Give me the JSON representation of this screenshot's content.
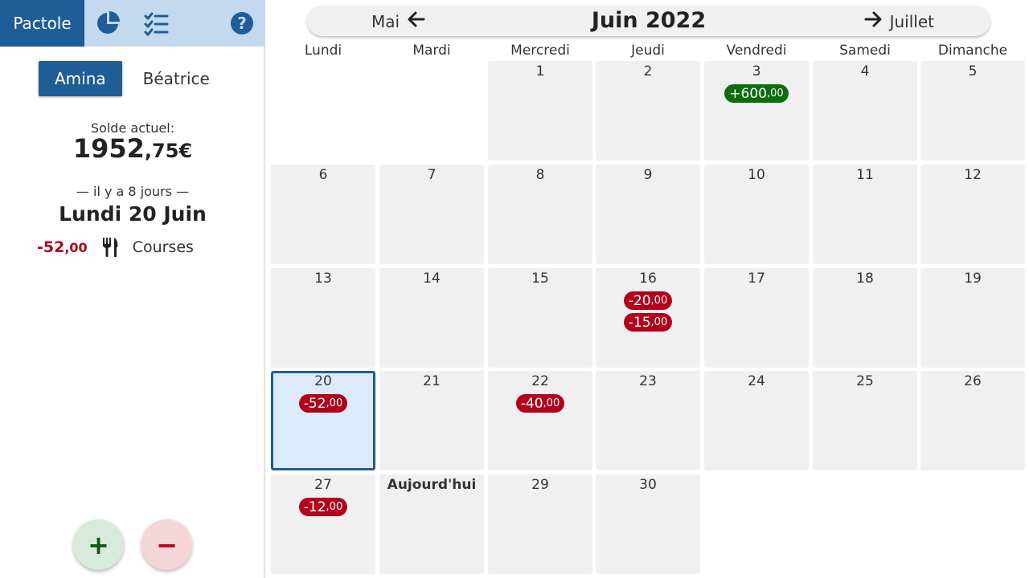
{
  "topbar": {
    "brand": "Pactole",
    "icons": [
      "pie-chart-icon",
      "checklist-icon",
      "help-icon"
    ]
  },
  "users": [
    {
      "name": "Amina",
      "active": true
    },
    {
      "name": "Béatrice",
      "active": false
    }
  ],
  "balance": {
    "label": "Solde actuel:",
    "units": "1952",
    "cents": ",75€"
  },
  "selected": {
    "since": "— il y a 8 jours —",
    "date": "Lundi 20 Juin",
    "transaction": {
      "units": "-52",
      "cents": ",00",
      "icon": "utensils-icon",
      "category": "Courses"
    }
  },
  "buttons": {
    "add": "+",
    "subtract": "−"
  },
  "nav": {
    "prev": "Mai",
    "title": "Juin 2022",
    "next": "Juillet"
  },
  "weekdays": [
    "Lundi",
    "Mardi",
    "Mercredi",
    "Jeudi",
    "Vendredi",
    "Samedi",
    "Dimanche"
  ],
  "days": [
    {
      "label": "1",
      "pills": []
    },
    {
      "label": "2",
      "pills": []
    },
    {
      "label": "3",
      "pills": [
        {
          "units": "+600",
          "cents": ",00",
          "type": "pos"
        }
      ]
    },
    {
      "label": "4",
      "pills": []
    },
    {
      "label": "5",
      "pills": []
    },
    {
      "label": "6",
      "pills": []
    },
    {
      "label": "7",
      "pills": []
    },
    {
      "label": "8",
      "pills": []
    },
    {
      "label": "9",
      "pills": []
    },
    {
      "label": "10",
      "pills": []
    },
    {
      "label": "11",
      "pills": []
    },
    {
      "label": "12",
      "pills": []
    },
    {
      "label": "13",
      "pills": []
    },
    {
      "label": "14",
      "pills": []
    },
    {
      "label": "15",
      "pills": []
    },
    {
      "label": "16",
      "pills": [
        {
          "units": "-20",
          "cents": ",00",
          "type": "neg"
        },
        {
          "units": "-15",
          "cents": ",00",
          "type": "neg"
        }
      ]
    },
    {
      "label": "17",
      "pills": []
    },
    {
      "label": "18",
      "pills": []
    },
    {
      "label": "19",
      "pills": []
    },
    {
      "label": "20",
      "pills": [
        {
          "units": "-52",
          "cents": ",00",
          "type": "neg"
        }
      ],
      "selected": true
    },
    {
      "label": "21",
      "pills": []
    },
    {
      "label": "22",
      "pills": [
        {
          "units": "-40",
          "cents": ",00",
          "type": "neg"
        }
      ]
    },
    {
      "label": "23",
      "pills": []
    },
    {
      "label": "24",
      "pills": []
    },
    {
      "label": "25",
      "pills": []
    },
    {
      "label": "26",
      "pills": []
    },
    {
      "label": "27",
      "pills": [
        {
          "units": "-12",
          "cents": ",00",
          "type": "neg"
        }
      ]
    },
    {
      "label": "Aujourd'hui",
      "pills": [],
      "today": true
    },
    {
      "label": "29",
      "pills": []
    },
    {
      "label": "30",
      "pills": []
    }
  ],
  "colors": {
    "primary": "#1f5d96",
    "topbar": "#c3d9ef",
    "negative": "#b3001b",
    "positive": "#0c6d0c",
    "cell": "#f0f0f0",
    "selected": "#dcebfb"
  }
}
